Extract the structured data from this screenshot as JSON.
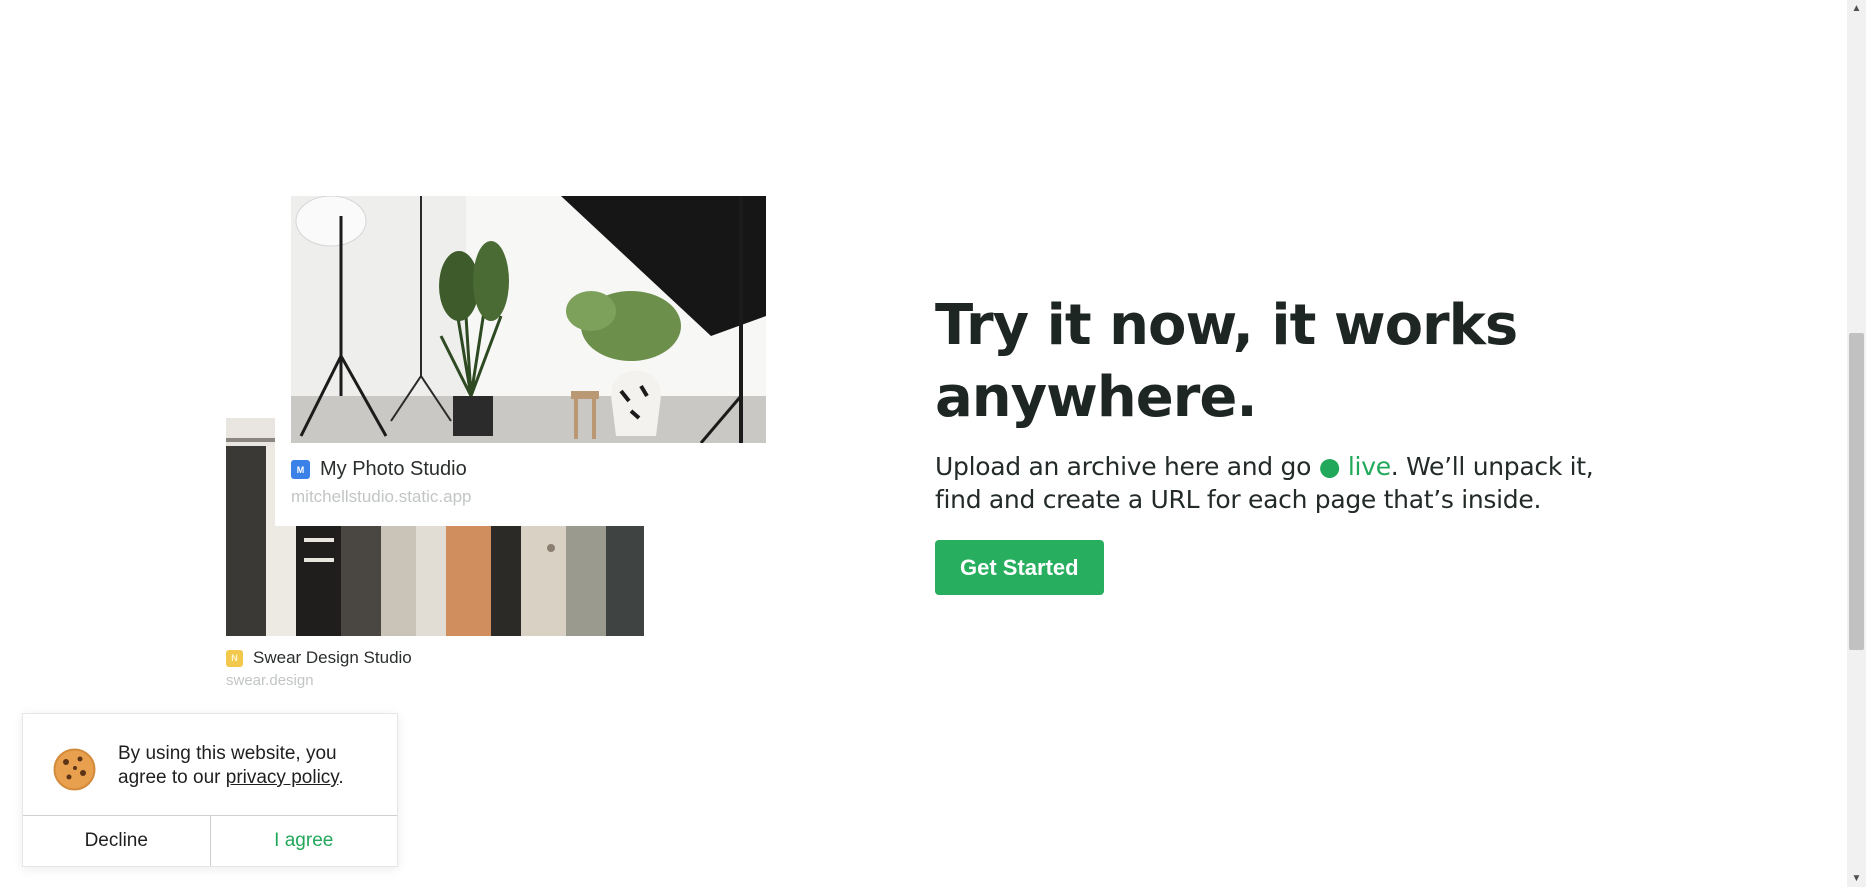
{
  "cards": {
    "back": {
      "icon_letter": "N",
      "title": "Swear Design Studio",
      "url": "swear.design"
    },
    "front": {
      "icon_letter": "M",
      "title": "My Photo Studio",
      "url": "mitchellstudio.static.app"
    }
  },
  "hero": {
    "title": "Try it now, it works anywhere.",
    "body_before": "Upload an archive here and go ",
    "live_dot": "●",
    "live_word": " live",
    "body_after": ". We’ll unpack it, find and create a URL for each page that’s inside.",
    "cta_label": "Get Started"
  },
  "cookie_banner": {
    "text_before": "By using this website, you agree to our ",
    "link_text": "privacy policy",
    "text_after": ".",
    "decline_label": "Decline",
    "agree_label": "I agree"
  },
  "colors": {
    "accent_green": "#27ae5f",
    "live_green": "#22a85a",
    "heading": "#1d2622",
    "muted_url": "#c2c6c3",
    "icon_blue": "#3b82e8",
    "icon_yellow": "#f2c94c"
  },
  "icons": {
    "cookie": "cookie-icon",
    "scroll_up": "scroll-up-arrow-icon",
    "scroll_down": "scroll-down-arrow-icon"
  }
}
